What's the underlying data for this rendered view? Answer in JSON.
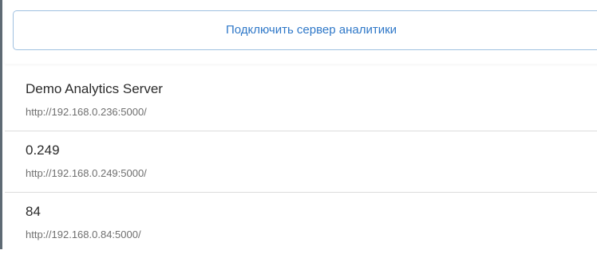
{
  "connect_button": {
    "label": "Подключить сервер аналитики"
  },
  "servers": [
    {
      "name": "Demo Analytics Server",
      "url": "http://192.168.0.236:5000/"
    },
    {
      "name": "0.249",
      "url": "http://192.168.0.249:5000/"
    },
    {
      "name": "84",
      "url": "http://192.168.0.84:5000/"
    }
  ],
  "colors": {
    "accent": "#2f78c8",
    "button_border": "#9fc0e0",
    "divider": "#dcdcdc",
    "text_primary": "#2b2b2b",
    "text_secondary": "#6f6f6f"
  }
}
